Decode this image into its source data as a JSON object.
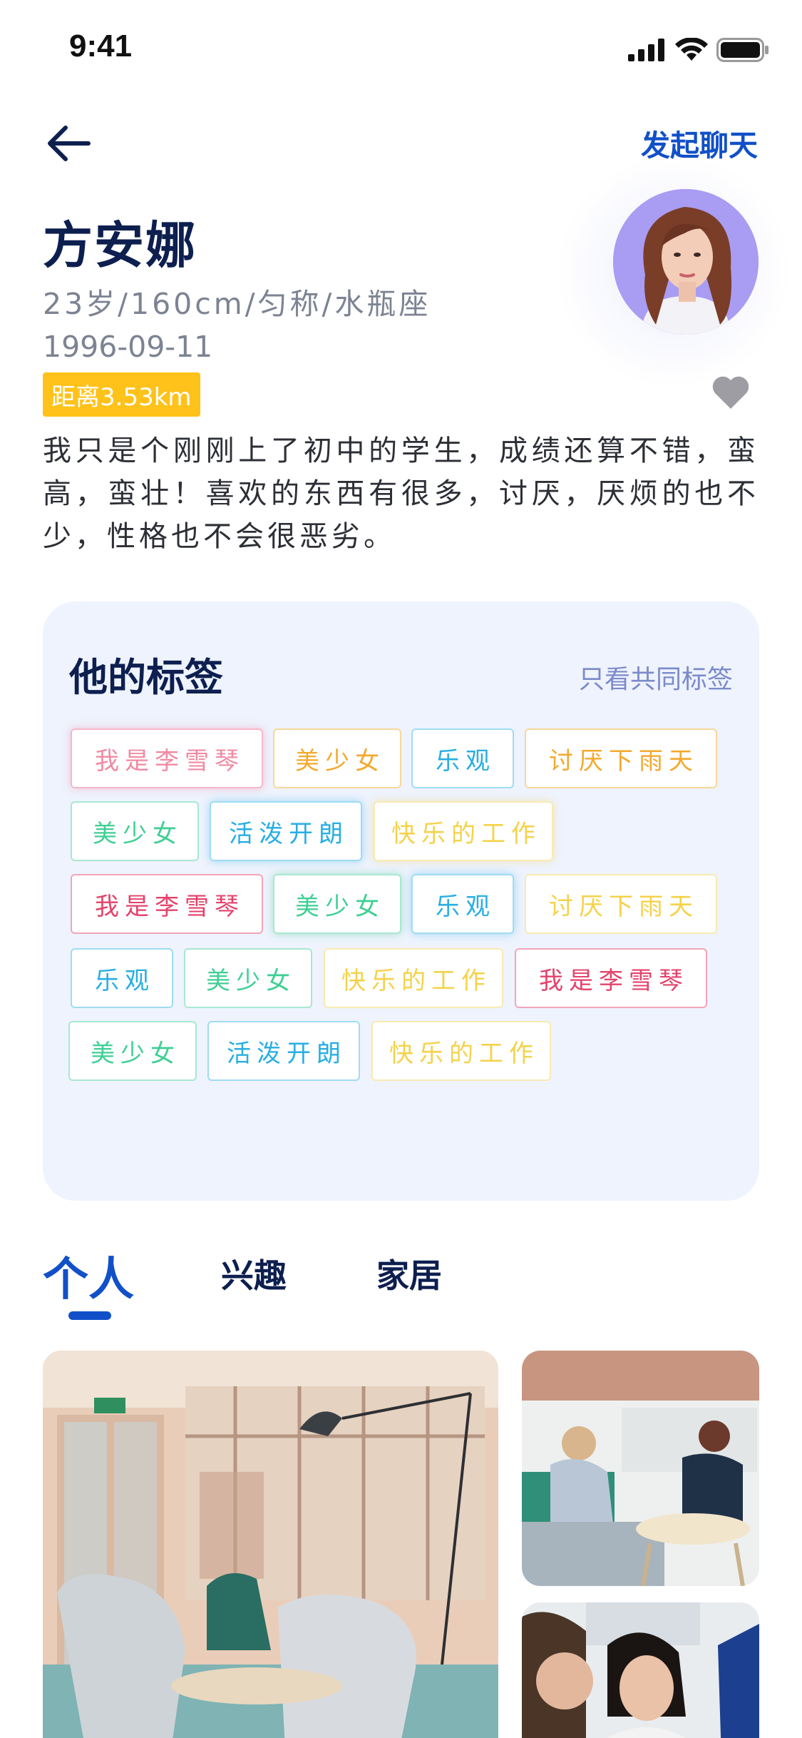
{
  "status_bar": {
    "time": "9:41"
  },
  "nav": {
    "chat_label": "发起聊天"
  },
  "profile": {
    "name": "方安娜",
    "meta": "23岁/160cm/匀称/水瓶座",
    "birthday": "1996-09-11",
    "distance": "距离3.53km",
    "bio": "我只是个刚刚上了初中的学生，成绩还算不错，蛮高，蛮壮！喜欢的东西有很多，讨厌，厌烦的也不少，性格也不会很恶劣。"
  },
  "tags_section": {
    "title": "他的标签",
    "filter_label": "只看共同标签",
    "tags": [
      "我是李雪琴",
      "美少女",
      "乐观",
      "讨厌下雨天",
      "美少女",
      "活泼开朗",
      "快乐的工作",
      "我是李雪琴",
      "美少女",
      "乐观",
      "讨厌下雨天",
      "乐观",
      "美少女",
      "快乐的工作",
      "我是李雪琴",
      "美少女",
      "活泼开朗",
      "快乐的工作"
    ]
  },
  "tabs": [
    "个人",
    "兴趣",
    "家居"
  ],
  "colors": {
    "accent": "#1150c8",
    "badge": "#ffc21a",
    "card_bg": "#eef3fd"
  }
}
